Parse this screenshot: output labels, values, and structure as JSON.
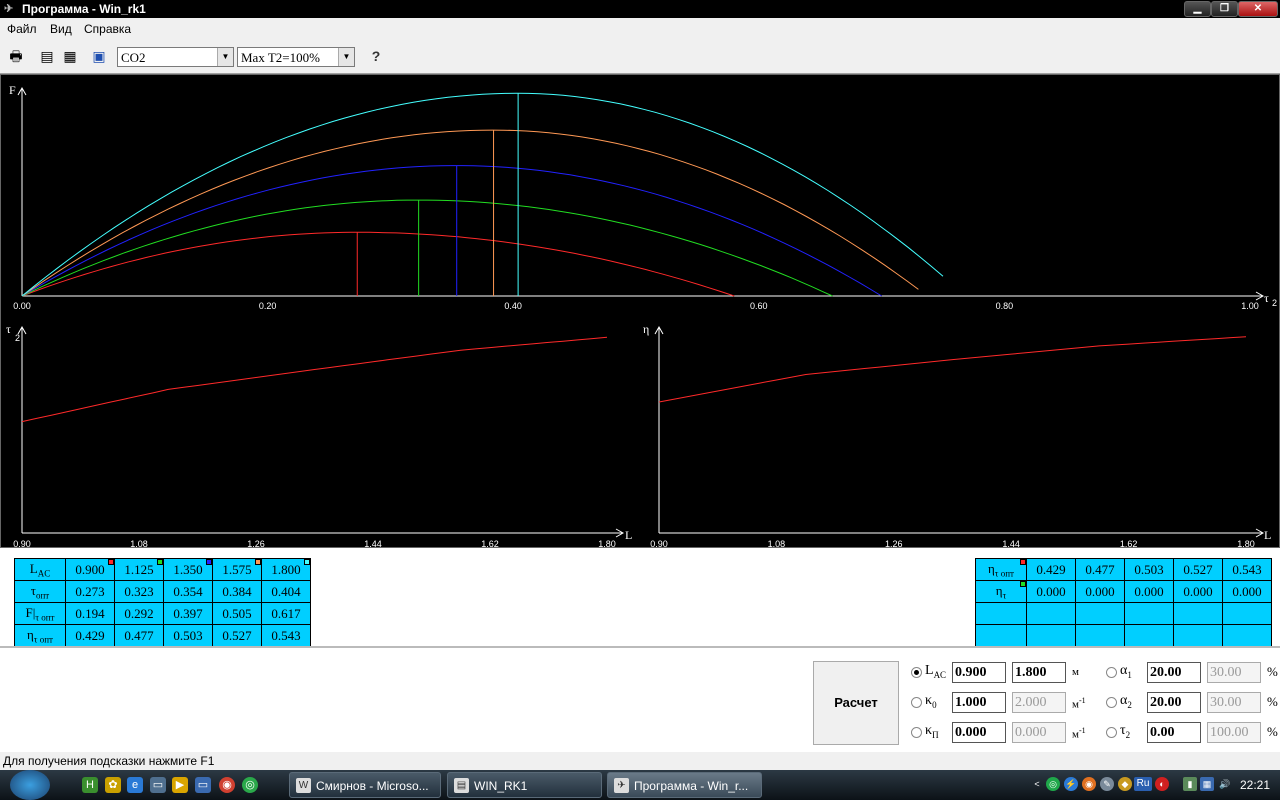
{
  "window": {
    "title": "Программа - Win_rk1",
    "min_glyph": "▁",
    "max_glyph": "❐",
    "close_glyph": "✕"
  },
  "menu": [
    "Файл",
    "Вид",
    "Справка"
  ],
  "toolbar": {
    "gas_select": "CO2",
    "max_select": "Max T2=100%",
    "icons": [
      "printer-icon",
      "open-icon",
      "window-icon",
      "calculator-icon",
      "help-icon"
    ]
  },
  "chart_data": [
    {
      "type": "line",
      "ylabel": "F",
      "xlabel": "τ",
      "xlabel_sub": "2",
      "xlim": [
        0,
        1
      ],
      "x_ticks": [
        "0.00",
        "0.20",
        "0.40",
        "0.60",
        "0.80",
        "1.00"
      ],
      "series": [
        {
          "color": "#ff2a2a",
          "peak_x": 0.273,
          "peak_y": 0.194,
          "end_x": 0.58,
          "end_y": 0.0
        },
        {
          "color": "#22dd22",
          "peak_x": 0.323,
          "peak_y": 0.292,
          "end_x": 0.66,
          "end_y": 0.0
        },
        {
          "color": "#2222ff",
          "peak_x": 0.354,
          "peak_y": 0.397,
          "end_x": 0.7,
          "end_y": 0.0
        },
        {
          "color": "#ff9955",
          "peak_x": 0.384,
          "peak_y": 0.505,
          "end_x": 0.73,
          "end_y": 0.02
        },
        {
          "color": "#44ffff",
          "peak_x": 0.404,
          "peak_y": 0.617,
          "end_x": 0.75,
          "end_y": 0.06
        }
      ],
      "ylim": [
        0,
        0.63
      ]
    },
    {
      "type": "line",
      "ylabel": "τ",
      "ylabel_sub": "2",
      "xlabel": "L",
      "xlim": [
        0.9,
        1.8
      ],
      "x_ticks": [
        "0.90",
        "1.08",
        "1.26",
        "1.44",
        "1.62",
        "1.80"
      ],
      "series": [
        {
          "color": "#ff2a2a",
          "x": [
            0.9,
            1.125,
            1.35,
            1.575,
            1.8
          ],
          "y": [
            0.273,
            0.323,
            0.354,
            0.384,
            0.404
          ]
        }
      ],
      "ylim": [
        0.1,
        0.42
      ]
    },
    {
      "type": "line",
      "ylabel": "η",
      "xlabel": "L",
      "xlim": [
        0.9,
        1.8
      ],
      "x_ticks": [
        "0.90",
        "1.08",
        "1.26",
        "1.44",
        "1.62",
        "1.80"
      ],
      "series": [
        {
          "color": "#ff2a2a",
          "x": [
            0.9,
            1.125,
            1.35,
            1.575,
            1.8
          ],
          "y": [
            0.429,
            0.477,
            0.503,
            0.527,
            0.543
          ]
        }
      ],
      "ylim": [
        0.2,
        0.56
      ]
    }
  ],
  "left_table": {
    "rows": [
      {
        "label": "L",
        "sub": "AC",
        "values": [
          "0.900",
          "1.125",
          "1.350",
          "1.575",
          "1.800"
        ]
      },
      {
        "label": "τ",
        "sub": "опт",
        "values": [
          "0.273",
          "0.323",
          "0.354",
          "0.384",
          "0.404"
        ]
      },
      {
        "label": "F|",
        "sub": "τ опт",
        "values": [
          "0.194",
          "0.292",
          "0.397",
          "0.505",
          "0.617"
        ]
      },
      {
        "label": "η",
        "sub": "τ опт",
        "values": [
          "0.429",
          "0.477",
          "0.503",
          "0.527",
          "0.543"
        ]
      }
    ],
    "marker_colors": [
      "#ff2a2a",
      "#22dd22",
      "#2222ff",
      "#ff9955",
      "#44ffff"
    ]
  },
  "right_table": {
    "rows": [
      {
        "label": "η",
        "sub": "τ опт",
        "values": [
          "0.429",
          "0.477",
          "0.503",
          "0.527",
          "0.543"
        ]
      },
      {
        "label": "η",
        "sub": "τ",
        "values": [
          "0.000",
          "0.000",
          "0.000",
          "0.000",
          "0.000"
        ]
      }
    ],
    "marker_colors": [
      "#ff2a2a",
      "#22dd22"
    ]
  },
  "form": {
    "calc_label": "Расчет",
    "left": [
      {
        "label": "L",
        "sub": "AC",
        "v1": "0.900",
        "v2": "1.800",
        "unit": "м",
        "unit_sup": "",
        "checked": true
      },
      {
        "label": "κ",
        "sub": "0",
        "v1": "1.000",
        "v2": "2.000",
        "unit": "м",
        "unit_sup": "-1",
        "checked": false
      },
      {
        "label": "κ",
        "sub": "П",
        "v1": "0.000",
        "v2": "0.000",
        "unit": "м",
        "unit_sup": "-1",
        "checked": false
      }
    ],
    "right": [
      {
        "label": "α",
        "sub": "1",
        "v1": "20.00",
        "v2": "30.00",
        "unit": "%"
      },
      {
        "label": "α",
        "sub": "2",
        "v1": "20.00",
        "v2": "30.00",
        "unit": "%"
      },
      {
        "label": "τ",
        "sub": "2",
        "v1": "0.00",
        "v2": "100.00",
        "unit": "%"
      }
    ]
  },
  "status": "Для получения подсказки нажмите F1",
  "taskbar": {
    "tasks": [
      "Смирнов - Microso...",
      "WIN_RK1",
      "Программа - Win_r..."
    ],
    "lang": "Ru",
    "clock": "22:21"
  }
}
